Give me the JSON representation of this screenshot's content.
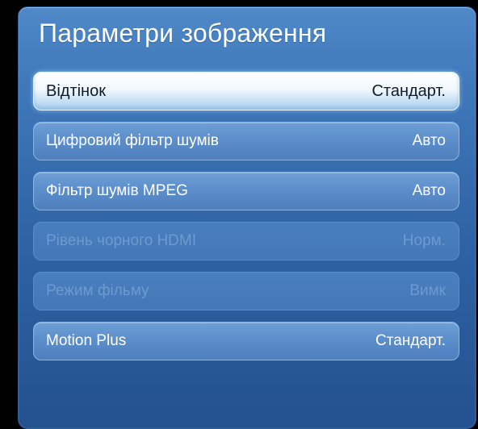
{
  "panel": {
    "title": "Параметри зображення"
  },
  "menu": {
    "items": [
      {
        "label": "Відтінок",
        "value": "Стандарт.",
        "state": "selected"
      },
      {
        "label": "Цифровий фільтр шумів",
        "value": "Авто",
        "state": "enabled"
      },
      {
        "label": "Фільтр шумів MPEG",
        "value": "Авто",
        "state": "enabled"
      },
      {
        "label": "Рівень чорного HDMI",
        "value": "Норм.",
        "state": "disabled"
      },
      {
        "label": "Режим фільму",
        "value": "Вимк",
        "state": "disabled"
      },
      {
        "label": "Motion Plus",
        "value": "Стандарт.",
        "state": "enabled"
      }
    ]
  }
}
